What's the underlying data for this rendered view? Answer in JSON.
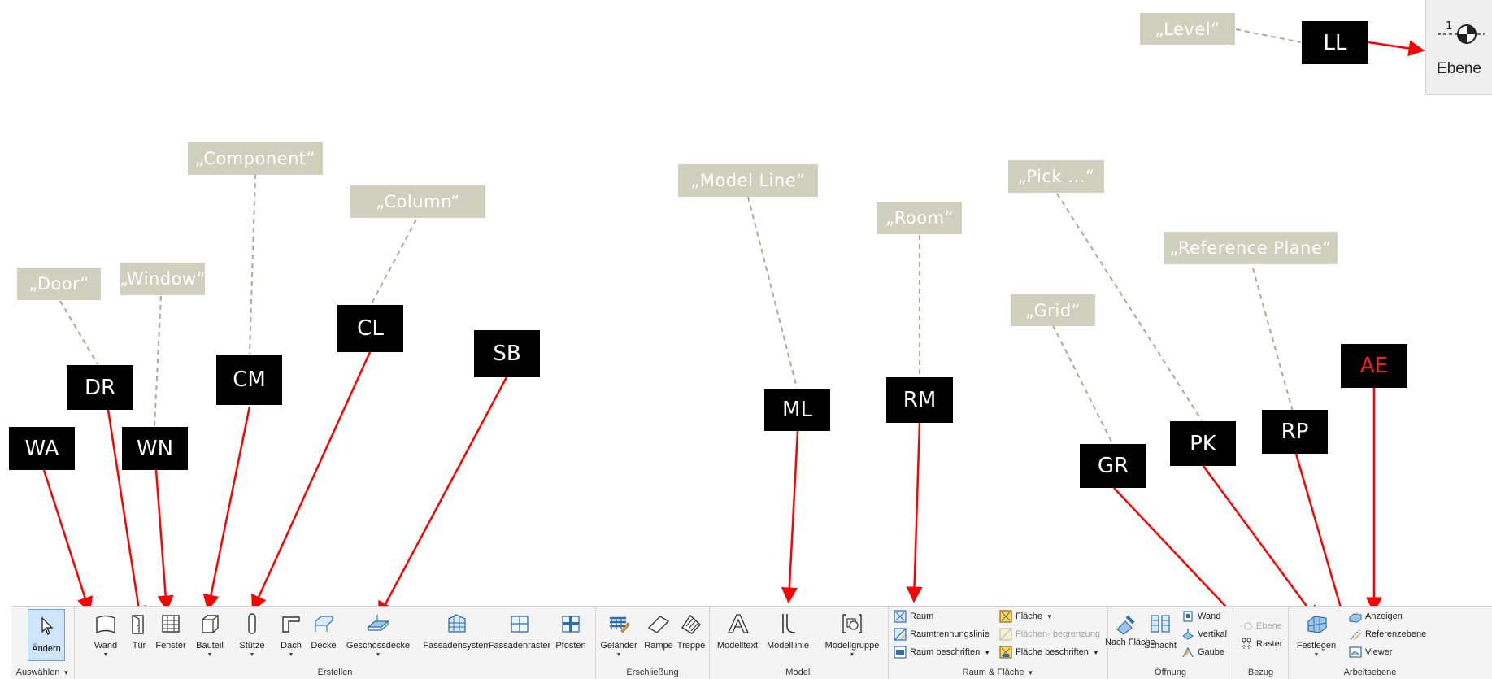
{
  "hints": {
    "level": "„Level“",
    "component": "„Component“",
    "column": "„Column“",
    "door": "„Door“",
    "window": "„Window“",
    "model_line": "„Model Line“",
    "room": "„Room“",
    "pick": "„Pick ...“",
    "reference_plane": "„Reference Plane“",
    "grid": "„Grid“"
  },
  "shortcuts": {
    "ll": "LL",
    "cl": "CL",
    "sb": "SB",
    "dr": "DR",
    "cm": "CM",
    "ml": "ML",
    "rm": "RM",
    "ae": "AE",
    "wa": "WA",
    "wn": "WN",
    "gr": "GR",
    "pk": "PK",
    "rp": "RP"
  },
  "ebene_button": {
    "label": "Ebene",
    "level_mark": "1"
  },
  "ribbon": {
    "auswaehlen": {
      "aendern": "Ändern",
      "title": "Auswählen"
    },
    "erstellen": {
      "title": "Erstellen",
      "buttons": [
        "Wand",
        "Tür",
        "Fenster",
        "Bauteil",
        "Stütze",
        "Dach",
        "Decke",
        "Geschossdecke",
        "Fassadensystem",
        "Fassadenraster",
        "Pfosten"
      ]
    },
    "erschliessung": {
      "title": "Erschließung",
      "buttons": [
        "Geländer",
        "Rampe",
        "Treppe"
      ]
    },
    "modell": {
      "title": "Modell",
      "buttons": [
        "Modelltext",
        "Modelllinie",
        "Modellgruppe"
      ]
    },
    "raum_flaeche": {
      "title": "Raum & Fläche",
      "items": [
        "Raum",
        "Raumtrennungslinie",
        "Raum  beschriften",
        "Fläche",
        "Flächen- begrenzung",
        "Fläche  beschriften"
      ]
    },
    "oeffnung": {
      "title": "Öffnung",
      "buttons": [
        "Nach Fläche",
        "Schacht"
      ],
      "small": [
        "Wand",
        "Vertikal",
        "Gaube"
      ]
    },
    "bezug": {
      "title": "Bezug",
      "items": [
        "Ebene",
        "Raster"
      ]
    },
    "arbeitsebene": {
      "title": "Arbeitsebene",
      "festlegen": "Festlegen",
      "items": [
        "Anzeigen",
        "Referenzebene",
        "Viewer"
      ]
    }
  },
  "colors": {
    "hint_bg": "#cfd0bd",
    "arrow": "#ff0000",
    "leader": "#a9ab92",
    "ribbon_bg": "#f4f4f4",
    "highlight": "#cfe5fb"
  }
}
